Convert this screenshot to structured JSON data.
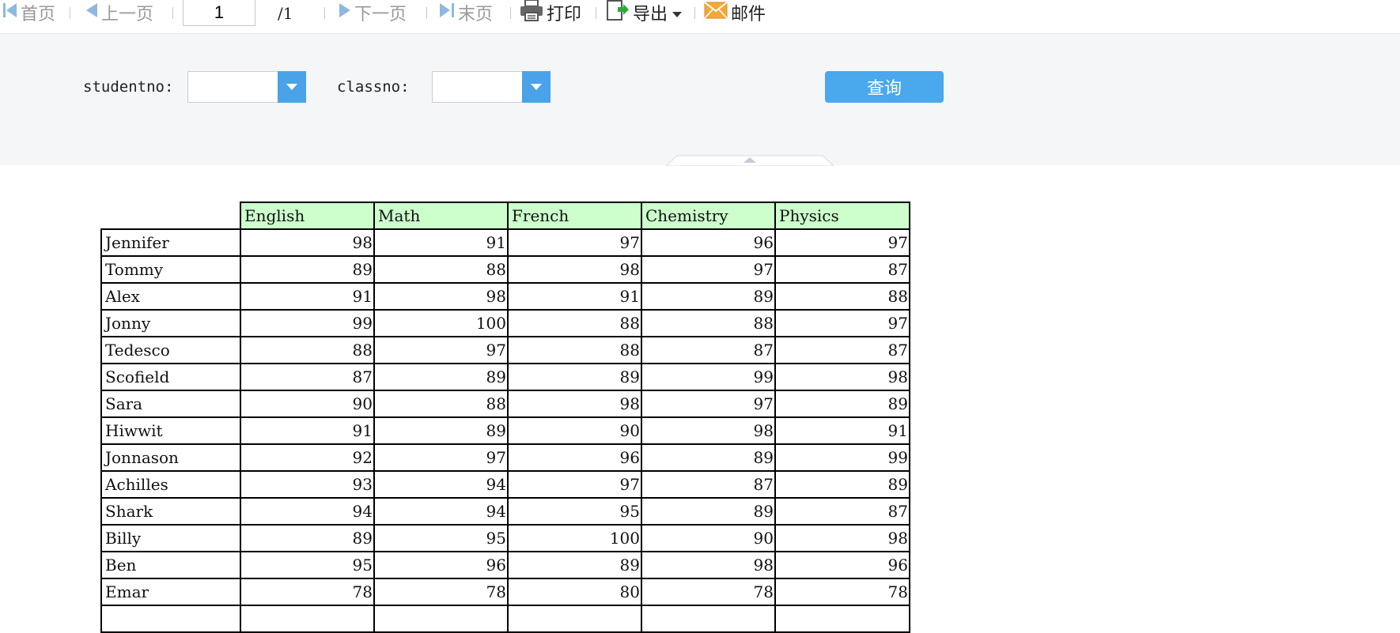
{
  "toolbar": {
    "first": "首页",
    "prev": "上一页",
    "page_current": "1",
    "page_total": "/1",
    "next": "下一页",
    "last": "末页",
    "print": "打印",
    "export": "导出",
    "mail": "邮件"
  },
  "params": {
    "studentno_label": "studentno:",
    "studentno_value": "",
    "classno_label": "classno:",
    "classno_value": "",
    "query_label": "查询"
  },
  "table": {
    "columns": [
      "English",
      "Math",
      "French",
      "Chemistry",
      "Physics"
    ],
    "rows": [
      {
        "name": "Jennifer",
        "scores": [
          "98",
          "91",
          "97",
          "96",
          "97"
        ]
      },
      {
        "name": "Tommy",
        "scores": [
          "89",
          "88",
          "98",
          "97",
          "87"
        ]
      },
      {
        "name": "Alex",
        "scores": [
          "91",
          "98",
          "91",
          "89",
          "88"
        ]
      },
      {
        "name": "Jonny",
        "scores": [
          "99",
          "100",
          "88",
          "88",
          "97"
        ]
      },
      {
        "name": "Tedesco",
        "scores": [
          "88",
          "97",
          "88",
          "87",
          "87"
        ]
      },
      {
        "name": "Scofield",
        "scores": [
          "87",
          "89",
          "89",
          "99",
          "98"
        ]
      },
      {
        "name": "Sara",
        "scores": [
          "90",
          "88",
          "98",
          "97",
          "89"
        ]
      },
      {
        "name": "Hiwwit",
        "scores": [
          "91",
          "89",
          "90",
          "98",
          "91"
        ]
      },
      {
        "name": "Jonnason",
        "scores": [
          "92",
          "97",
          "96",
          "89",
          "99"
        ]
      },
      {
        "name": "Achilles",
        "scores": [
          "93",
          "94",
          "97",
          "87",
          "89"
        ]
      },
      {
        "name": "Shark",
        "scores": [
          "94",
          "94",
          "95",
          "89",
          "87"
        ]
      },
      {
        "name": "Billy",
        "scores": [
          "89",
          "95",
          "100",
          "90",
          "98"
        ]
      },
      {
        "name": "Ben",
        "scores": [
          "95",
          "96",
          "89",
          "98",
          "96"
        ]
      },
      {
        "name": "Emar",
        "scores": [
          "78",
          "78",
          "80",
          "78",
          "78"
        ]
      }
    ]
  },
  "colors": {
    "header_bg": "#ccffcc",
    "accent": "#4aa8ec",
    "panel_bg": "#f5f6f8",
    "disabled_text": "#999999"
  }
}
